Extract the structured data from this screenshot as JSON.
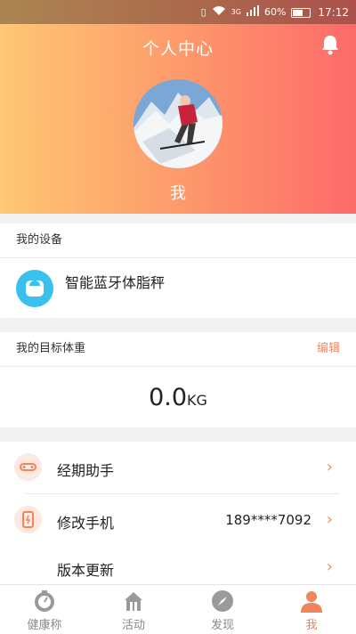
{
  "status_bar": {
    "network": "3G",
    "battery": "60%",
    "time": "17:12"
  },
  "header": {
    "title": "个人中心",
    "nickname": "我"
  },
  "devices": {
    "heading": "我的设备",
    "items": [
      {
        "name": "智能蓝牙体脂秤"
      }
    ]
  },
  "target_weight": {
    "heading": "我的目标体重",
    "edit_label": "编辑",
    "value": "0.0",
    "unit": "KG"
  },
  "menu": [
    {
      "label": "经期助手",
      "value": ""
    },
    {
      "label": "修改手机",
      "value": "189****7092"
    },
    {
      "label": "版本更新",
      "value": ""
    }
  ],
  "tabs": [
    {
      "label": "健康称",
      "icon": "scale-icon",
      "active": false
    },
    {
      "label": "活动",
      "icon": "activity-icon",
      "active": false
    },
    {
      "label": "发现",
      "icon": "compass-icon",
      "active": false
    },
    {
      "label": "我",
      "icon": "person-icon",
      "active": true
    }
  ],
  "colors": {
    "accent": "#f0845c",
    "gradient_start": "#fec874",
    "gradient_end": "#fd6a6a",
    "device_icon": "#39c0ec"
  }
}
